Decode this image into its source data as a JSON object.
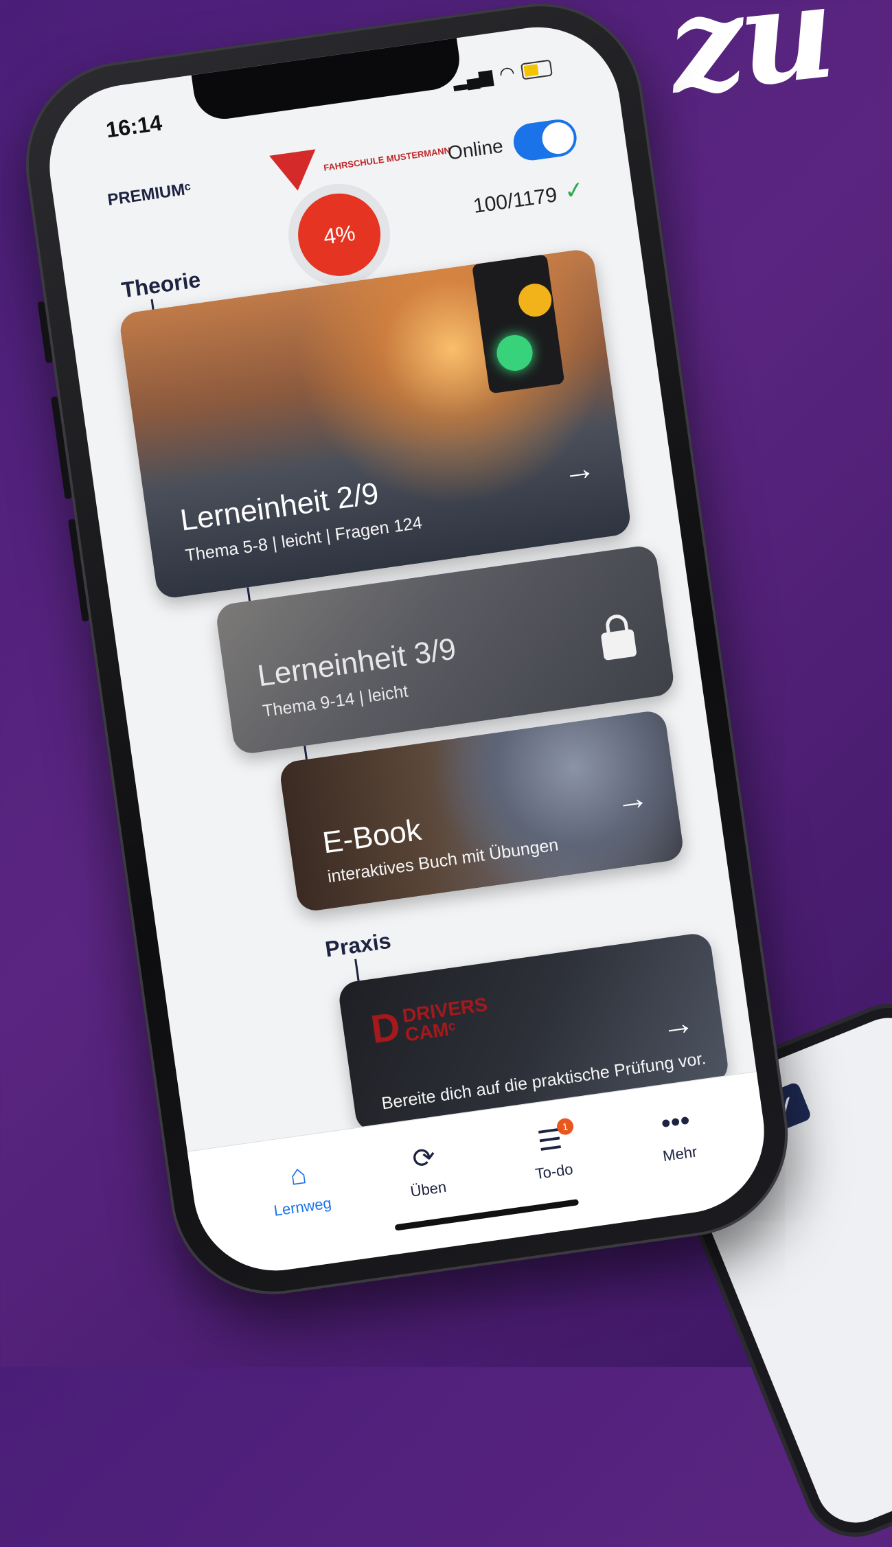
{
  "status_bar": {
    "time": "16:14"
  },
  "header": {
    "plan_label": "PREMIUMᶜ",
    "school_logo_text": "FAHRSCHULE MUSTERMANN",
    "online_label": "Online",
    "online_enabled": true
  },
  "progress": {
    "percent_label": "4%",
    "answered_label": "100/1179",
    "check_symbol": "✓"
  },
  "sections": {
    "theory_title": "Theorie",
    "practice_title": "Praxis"
  },
  "cards": [
    {
      "title": "Lerneinheit 2/9",
      "subtitle": "Thema 5-8 | leicht | Fragen 124",
      "locked": false,
      "arrow": "→"
    },
    {
      "title": "Lerneinheit 3/9",
      "subtitle": "Thema 9-14 | leicht",
      "locked": true
    },
    {
      "title": "E-Book",
      "subtitle": "interaktives Buch mit Übungen",
      "locked": false,
      "arrow": "→"
    },
    {
      "brand_line1": "DRIVERS",
      "brand_line2": "CAMᶜ",
      "subtitle": "Bereite dich auf die praktische Prüfung vor.",
      "arrow": "→"
    }
  ],
  "tabbar": {
    "items": [
      {
        "label": "Lernweg",
        "icon": "home-icon",
        "active": true
      },
      {
        "label": "Üben",
        "icon": "refresh-icon",
        "active": false
      },
      {
        "label": "To-do",
        "icon": "checklist-icon",
        "badge": "1",
        "active": false
      },
      {
        "label": "Mehr",
        "icon": "more-icon",
        "active": false
      }
    ]
  },
  "decor": {
    "headline_fragment": "zu"
  },
  "colors": {
    "background": "#4a1e78",
    "accent_blue": "#1a73e8",
    "progress_red": "#e53522",
    "text_navy": "#1d2340"
  }
}
